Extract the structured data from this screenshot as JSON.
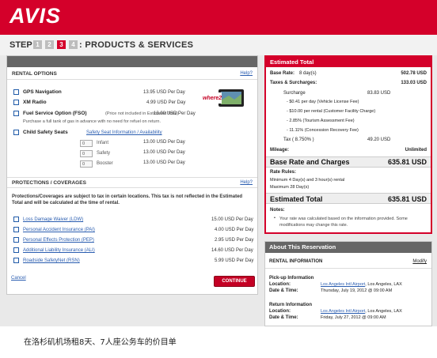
{
  "brand": {
    "logo_text": "AVIS",
    "accent": "#d4002a"
  },
  "stepper": {
    "label": "STEP",
    "steps": [
      "1",
      "2",
      "3",
      "4"
    ],
    "active_step": "3",
    "title": ": PRODUCTS & SERVICES"
  },
  "rental_options": {
    "header": "RENTAL OPTIONS",
    "help": "Help?",
    "items": [
      {
        "label": "GPS Navigation",
        "price": "13.95 USD Per Day"
      },
      {
        "label": "XM Radio",
        "price": "4.99 USD Per Day"
      },
      {
        "label": "Fuel Service Option (FSO)",
        "note": "(Price not included in Estimated Total)",
        "price": "13.00 USD Per Day",
        "sub": "Purchase a full tank of gas in advance with no need for refuel on return."
      },
      {
        "label": "Child Safety Seats",
        "link": "Safety Seat Information / Availability"
      }
    ],
    "seats": [
      {
        "qty": "0",
        "label": "Infant",
        "price": "13.00 USD Per Day"
      },
      {
        "qty": "0",
        "label": "Safety",
        "price": "13.00 USD Per Day"
      },
      {
        "qty": "0",
        "label": "Booster",
        "price": "13.00 USD Per Day"
      }
    ],
    "gps_image_text": "where2"
  },
  "protections": {
    "header": "PROTECTIONS / COVERAGES",
    "help": "Help?",
    "notice": "Protections/Coverages are subject to tax in certain locations. This tax is not reflected in the Estimated Total and will be calculated at the time of rental.",
    "items": [
      {
        "label": "Loss Damage Waiver (LDW)",
        "price": "15.00 USD Per Day"
      },
      {
        "label": "Personal Accident Insurance (PAI)",
        "price": "4.00 USD Per Day"
      },
      {
        "label": "Personal Effects Protection (PEP)",
        "price": "2.95 USD Per Day"
      },
      {
        "label": "Additional Liability Insurance (ALI)",
        "price": "14.60 USD Per Day"
      },
      {
        "label": "Roadside SafetyNet (RSN)",
        "price": "5.99 USD Per Day"
      }
    ],
    "cancel": "Cancel",
    "continue": "CONTINUE"
  },
  "estimate": {
    "title": "Estimated Total",
    "base_rate_label": "Base Rate:",
    "base_rate_days": "8 day(s)",
    "base_rate_value": "502.78 USD",
    "taxes_label": "Taxes & Surcharges:",
    "taxes_value": "133.03 USD",
    "surcharge_label": "Surcharge",
    "surcharge_value": "83.83 USD",
    "surcharge_items": [
      "- $0.41 per day (Vehicle License Fee)",
      "- $10.00 per rental (Customer Facility Charge)",
      "- 2.85% (Tourism Assessment Fee)",
      "- 11.11% (Concession Recovery Fee)"
    ],
    "tax_label": "Tax ( 8.750% )",
    "tax_value": "49.20 USD",
    "mileage_label": "Mileage:",
    "mileage_value": "Unlimited",
    "base_charges_label": "Base Rate and Charges",
    "base_charges_value": "635.81 USD",
    "rules_label": "Rate Rules:",
    "rules": [
      "Minimum 4 Day(s) and 3 hour(s) rental",
      "Maximum 28 Day(s)"
    ],
    "total_label": "Estimated Total",
    "total_value": "635.81 USD",
    "notes_label": "Notes:",
    "notes": "Your rate was calculated based on the information provided. Some modifications may change this rate."
  },
  "about": {
    "title": "About This Reservation",
    "section": "RENTAL INFORMATION",
    "modify": "Modify",
    "pickup_header": "Pick-up Information",
    "pickup_location_label": "Location:",
    "pickup_location_link": "Los Angeles Intl Airport",
    "pickup_location_rest": ", Los Angeles, LAX",
    "pickup_date_label": "Date & Time:",
    "pickup_date": "Thursday, July 19, 2012 @ 09:00 AM",
    "return_header": "Return Information",
    "return_location_label": "Location:",
    "return_location_link": "Los Angeles Intl Airport",
    "return_location_rest": ", Los Angeles, LAX",
    "return_date_label": "Date & Time:",
    "return_date": "Friday, July 27, 2012 @ 09:00 AM"
  },
  "caption": "在洛杉矶机场租8天、7人座公务车的价目单"
}
